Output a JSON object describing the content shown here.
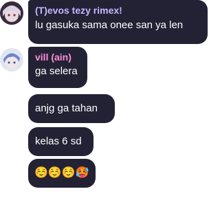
{
  "messages": [
    {
      "sender": "(T)evos tezy rimex!",
      "sender_color": "#c8b6ff",
      "avatar": "anime-avatar-white-hair",
      "text": "lu gasuka sama onee san ya len"
    },
    {
      "sender": "vill (ain)",
      "sender_color": "#ff8fd8",
      "avatar": "anime-avatar-blue-hair",
      "text": "ga selera"
    },
    {
      "text": "anjg ga tahan"
    },
    {
      "text": "kelas 6 sd"
    },
    {
      "text": "☺️☺️☺️🥵"
    }
  ],
  "colors": {
    "bubble": "#232235",
    "text": "#ffffff",
    "background": "#ffffff"
  }
}
